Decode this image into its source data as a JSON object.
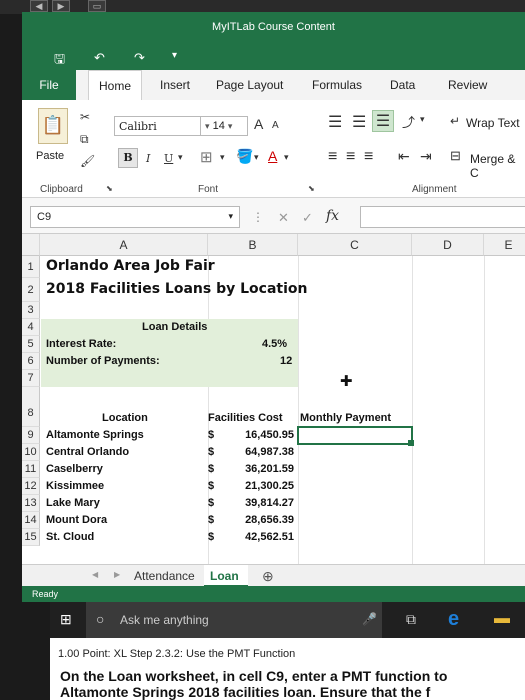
{
  "window": {
    "title": "MyITLab Course Content"
  },
  "qat": {
    "save": "🖫",
    "undo": "↶",
    "redo": "↷"
  },
  "tabs": [
    "File",
    "Home",
    "Insert",
    "Page Layout",
    "Formulas",
    "Data",
    "Review"
  ],
  "ribbon": {
    "font_name": "Calibri",
    "font_size": "14",
    "paste": "Paste",
    "clipboard": "Clipboard",
    "font_group": "Font",
    "alignment_group": "Alignment",
    "wrap_text": "Wrap Text",
    "merge": "Merge & C",
    "bold": "B",
    "italic": "I",
    "underline": "U",
    "grow": "A",
    "shrink": "A",
    "font_color": "A"
  },
  "formula_bar": {
    "name_box": "C9",
    "fx": "fx",
    "value": ""
  },
  "columns": [
    "A",
    "B",
    "C",
    "D",
    "E"
  ],
  "rows": [
    "1",
    "2",
    "3",
    "4",
    "5",
    "6",
    "7",
    "8",
    "9",
    "10",
    "11",
    "12",
    "13",
    "14",
    "15"
  ],
  "sheet": {
    "title1": "Orlando Area Job Fair",
    "title2": "2018 Facilities Loans by Location",
    "loan_details": "Loan Details",
    "interest_label": "Interest Rate:",
    "interest_value": "4.5%",
    "payments_label": "Number of Payments:",
    "payments_value": "12",
    "header_location": "Location",
    "header_cost": "Facilities Cost",
    "header_payment": "Monthly Payment",
    "data": [
      {
        "location": "Altamonte Springs",
        "cur": "$",
        "cost": "16,450.95"
      },
      {
        "location": "Central Orlando",
        "cur": "$",
        "cost": "64,987.38"
      },
      {
        "location": "Caselberry",
        "cur": "$",
        "cost": "36,201.59"
      },
      {
        "location": "Kissimmee",
        "cur": "$",
        "cost": "21,300.25"
      },
      {
        "location": "Lake Mary",
        "cur": "$",
        "cost": "39,814.27"
      },
      {
        "location": "Mount Dora",
        "cur": "$",
        "cost": "28,656.39"
      },
      {
        "location": "St. Cloud",
        "cur": "$",
        "cost": "42,562.51"
      }
    ]
  },
  "sheet_tabs": {
    "tab1": "Attendance",
    "tab2": "Loan",
    "add": "⊕",
    "prev": "◀",
    "next": "▶"
  },
  "status": "Ready",
  "taskbar": {
    "search": "Ask me anything"
  },
  "instructions": {
    "point": "1.00 Point: XL Step 2.3.2: Use the PMT Function",
    "text": "On the Loan worksheet, in cell C9, enter a PMT function to",
    "text2": "Altamonte Springs 2018 facilities loan. Ensure that the f"
  },
  "colors": {
    "excel_green": "#217346",
    "cell_green": "#e2efda",
    "edge_blue": "#1e7fd8"
  }
}
